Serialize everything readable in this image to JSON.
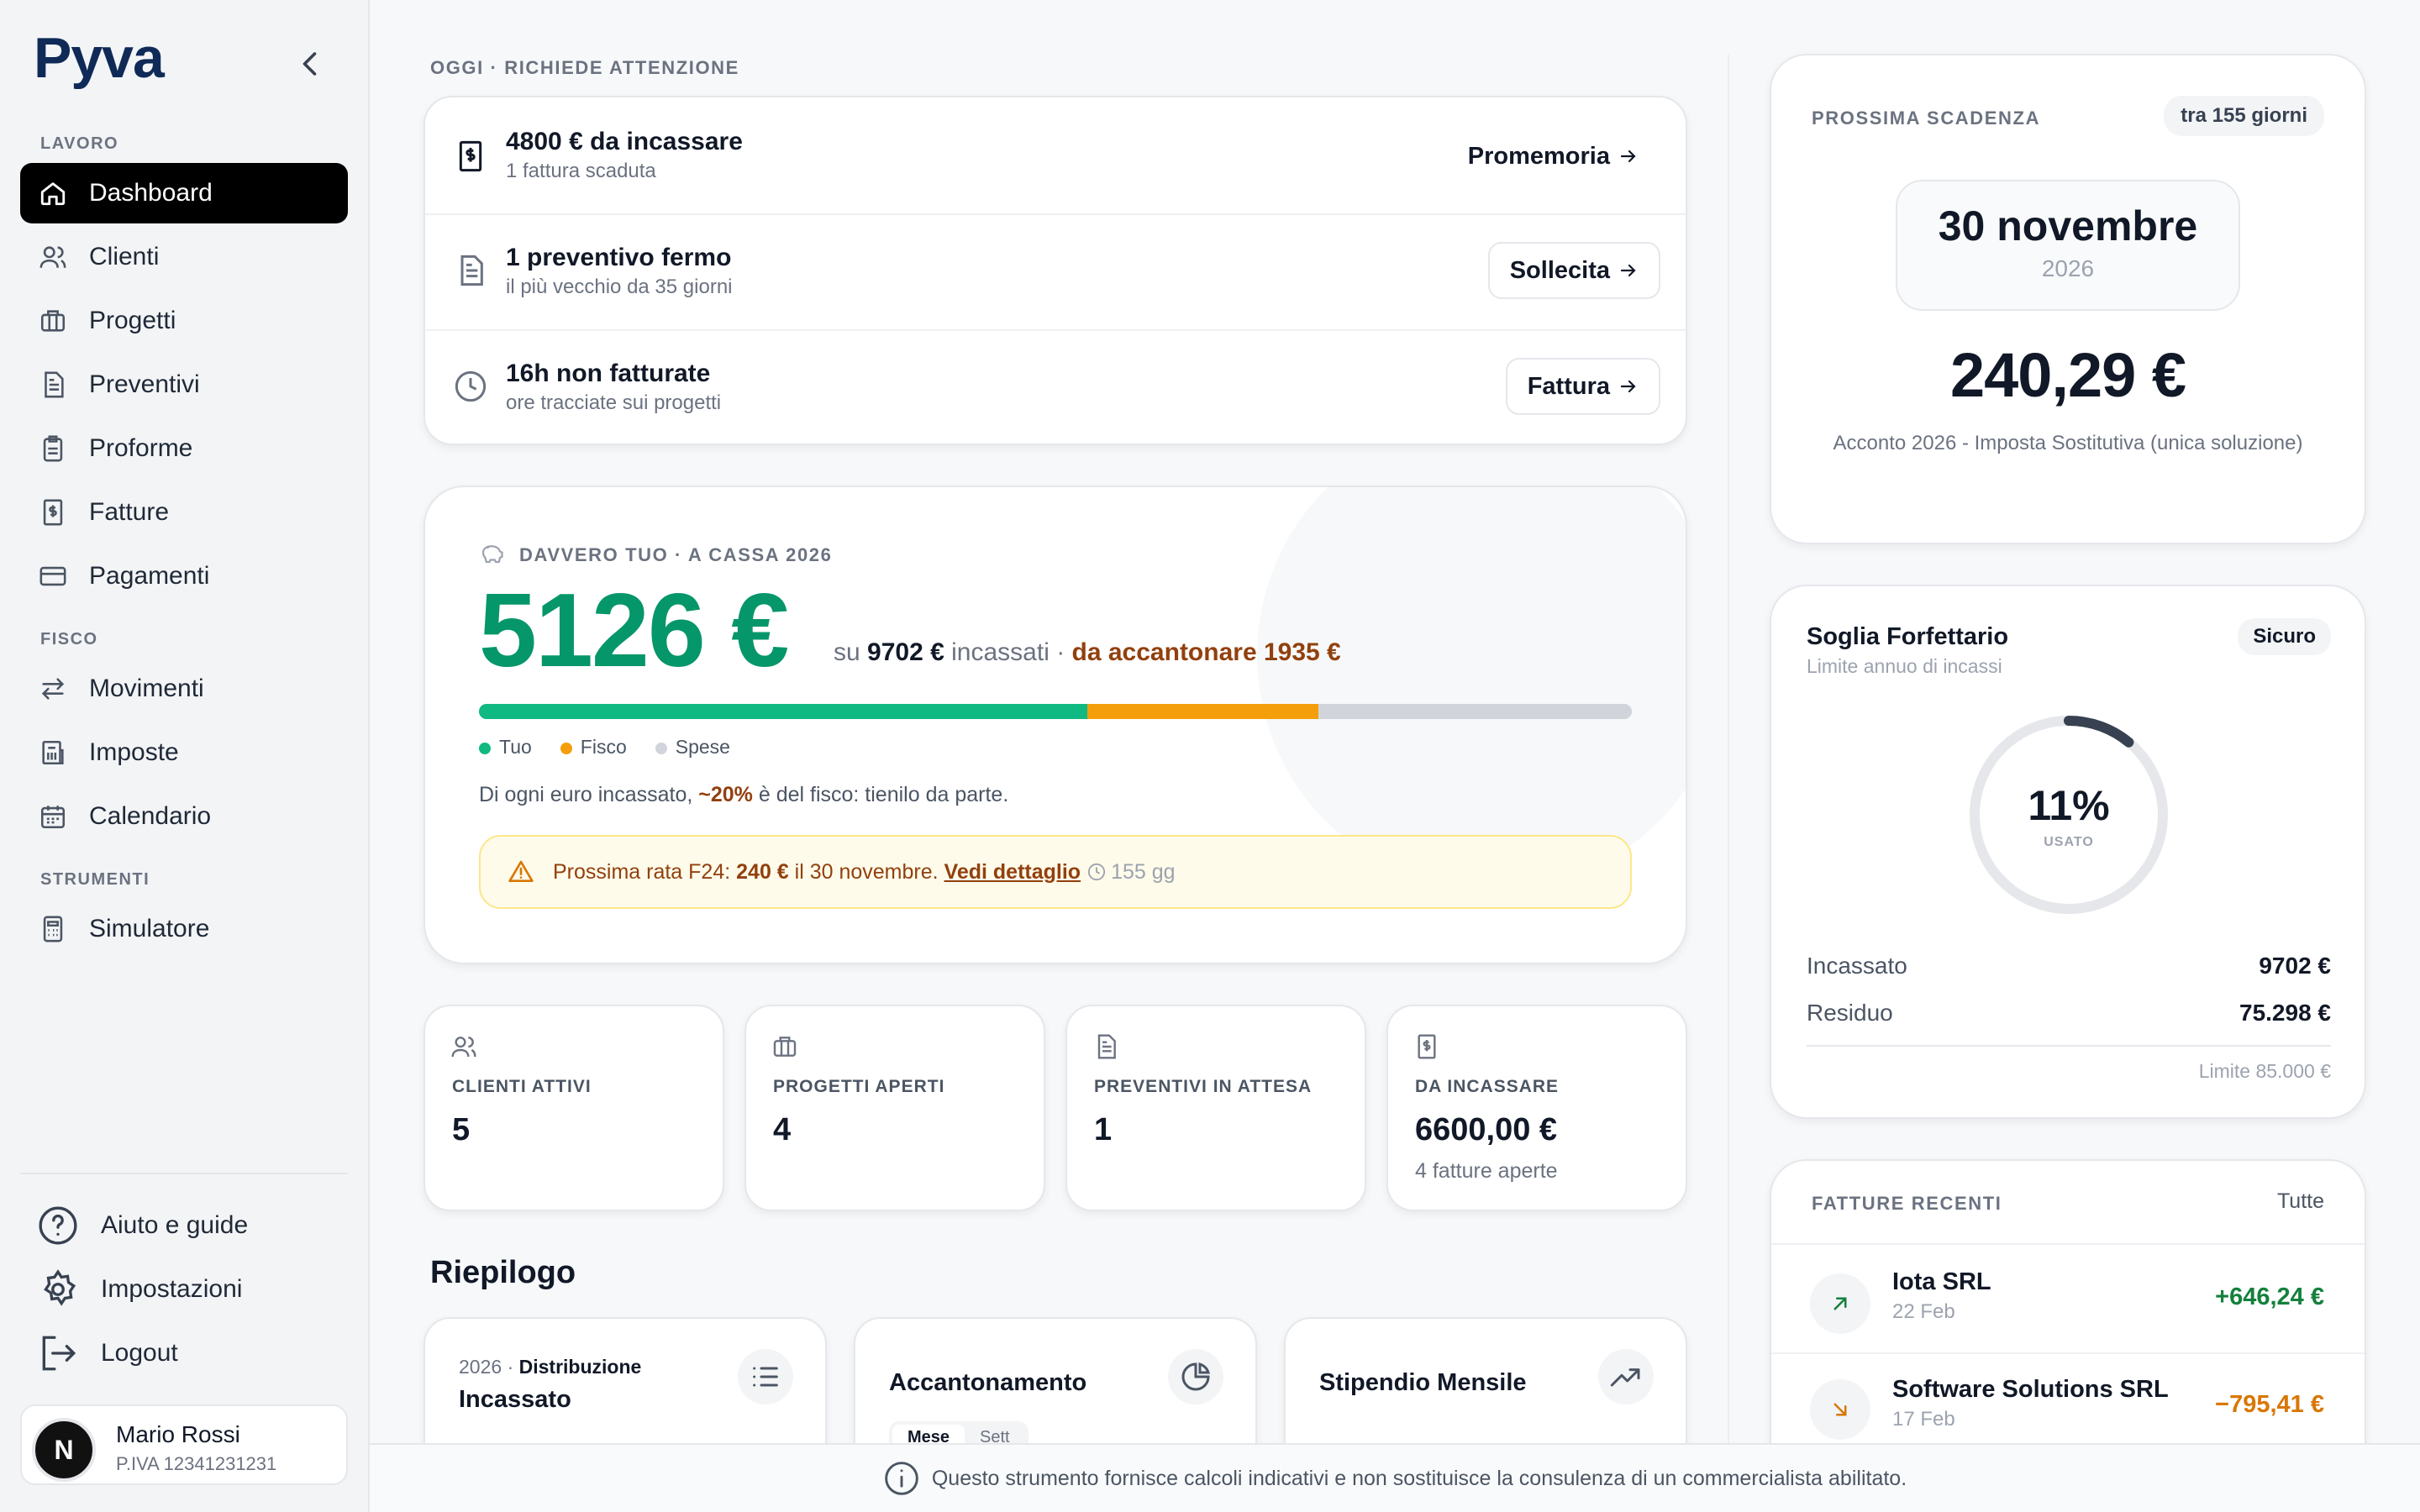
{
  "sidebar": {
    "logo": "Pyva",
    "sections": {
      "lavoro": "LAVORO",
      "fisco": "FISCO",
      "strumenti": "STRUMENTI"
    },
    "items": [
      {
        "label": "Dashboard",
        "icon": "home-icon"
      },
      {
        "label": "Clienti",
        "icon": "users-icon"
      },
      {
        "label": "Progetti",
        "icon": "briefcase-icon"
      },
      {
        "label": "Preventivi",
        "icon": "document-icon"
      },
      {
        "label": "Proforme",
        "icon": "clipboard-icon"
      },
      {
        "label": "Fatture",
        "icon": "invoice-icon"
      },
      {
        "label": "Pagamenti",
        "icon": "credit-card-icon"
      },
      {
        "label": "Movimenti",
        "icon": "arrows-icon"
      },
      {
        "label": "Imposte",
        "icon": "bank-icon"
      },
      {
        "label": "Calendario",
        "icon": "calendar-icon"
      },
      {
        "label": "Simulatore",
        "icon": "calculator-icon"
      }
    ],
    "utilities": [
      {
        "label": "Aiuto e guide",
        "icon": "help-icon"
      },
      {
        "label": "Impostazioni",
        "icon": "gear-icon"
      },
      {
        "label": "Logout",
        "icon": "logout-icon"
      }
    ],
    "user": {
      "initial": "N",
      "name": "Mario Rossi",
      "piva": "P.IVA 12341231231"
    }
  },
  "attention": {
    "title": "OGGI · RICHIEDE ATTENZIONE",
    "rows": [
      {
        "title": "4800 € da incassare",
        "subtitle": "1 fattura scaduta",
        "action": "Promemoria"
      },
      {
        "title": "1 preventivo fermo",
        "subtitle": "il più vecchio da 35 giorni",
        "action": "Sollecita"
      },
      {
        "title": "16h non fatturate",
        "subtitle": "ore tracciate sui progetti",
        "action": "Fattura"
      }
    ]
  },
  "cash": {
    "label": "DAVVERO TUO · A CASSA 2026",
    "amount": "5126 €",
    "su": "su",
    "incassati_value": "9702 €",
    "incassati_label": "incassati ·",
    "accantonare": "da accantonare 1935 €",
    "bar": {
      "tuo": 0.528,
      "fisco": 0.2,
      "spese": 0.272
    },
    "legend": [
      "Tuo",
      "Fisco",
      "Spese"
    ],
    "colors": {
      "tuo": "#10b981",
      "fisco": "#f59e0b",
      "spese": "#d1d5db"
    },
    "note_pre": "Di ogni euro incassato,",
    "note_pct": "~20%",
    "note_post": "è del fisco: tienilo da parte.",
    "alert_pre": "Prossima rata F24:",
    "alert_amount": "240 €",
    "alert_mid": "il 30 novembre.",
    "alert_link": "Vedi dettaglio",
    "alert_days": "155 gg"
  },
  "stats": [
    {
      "label": "CLIENTI ATTIVI",
      "value": "5",
      "sub": "",
      "icon": "users-icon"
    },
    {
      "label": "PROGETTI APERTI",
      "value": "4",
      "sub": "",
      "icon": "briefcase-icon"
    },
    {
      "label": "PREVENTIVI IN ATTESA",
      "value": "1",
      "sub": "",
      "icon": "document-icon"
    },
    {
      "label": "DA INCASSARE",
      "value": "6600,00 €",
      "sub": "4 fatture aperte",
      "icon": "invoice-icon"
    }
  ],
  "riepilogo": {
    "title": "Riepilogo",
    "cards": [
      {
        "year": "2026",
        "dot": "·",
        "subtitle": "Distribuzione",
        "title": "Incassato",
        "icon": "list-icon"
      },
      {
        "title": "Accantonamento",
        "icon": "pie-icon",
        "tabs": [
          "Mese",
          "Sett"
        ]
      },
      {
        "title": "Stipendio Mensile",
        "icon": "trend-icon"
      }
    ]
  },
  "deadline": {
    "label": "PROSSIMA SCADENZA",
    "badge": "tra 155 giorni",
    "date": "30 novembre",
    "year": "2026",
    "amount": "240,29 €",
    "description": "Acconto 2026 - Imposta Sostitutiva (unica soluzione)"
  },
  "threshold": {
    "title": "Soglia Forfettario",
    "subtitle": "Limite annuo di incassi",
    "badge": "Sicuro",
    "percent": "11%",
    "percent_value": 0.11,
    "used": "USATO",
    "rows": [
      {
        "label": "Incassato",
        "value": "9702 €"
      },
      {
        "label": "Residuo",
        "value": "75.298 €"
      }
    ],
    "limit": "Limite 85.000 €"
  },
  "invoices": {
    "label": "FATTURE RECENTI",
    "all": "Tutte",
    "items": [
      {
        "name": "Iota SRL",
        "date": "22 Feb",
        "amount": "+646,24 €",
        "color": "#15803d",
        "icon": "arrow-up-right-icon"
      },
      {
        "name": "Software Solutions SRL",
        "date": "17 Feb",
        "amount": "−795,41 €",
        "color": "#d97706",
        "icon": "arrow-down-right-icon"
      }
    ]
  },
  "footer": {
    "disclaimer": "Questo strumento fornisce calcoli indicativi e non sostituisce la consulenza di un commercialista abilitato."
  }
}
